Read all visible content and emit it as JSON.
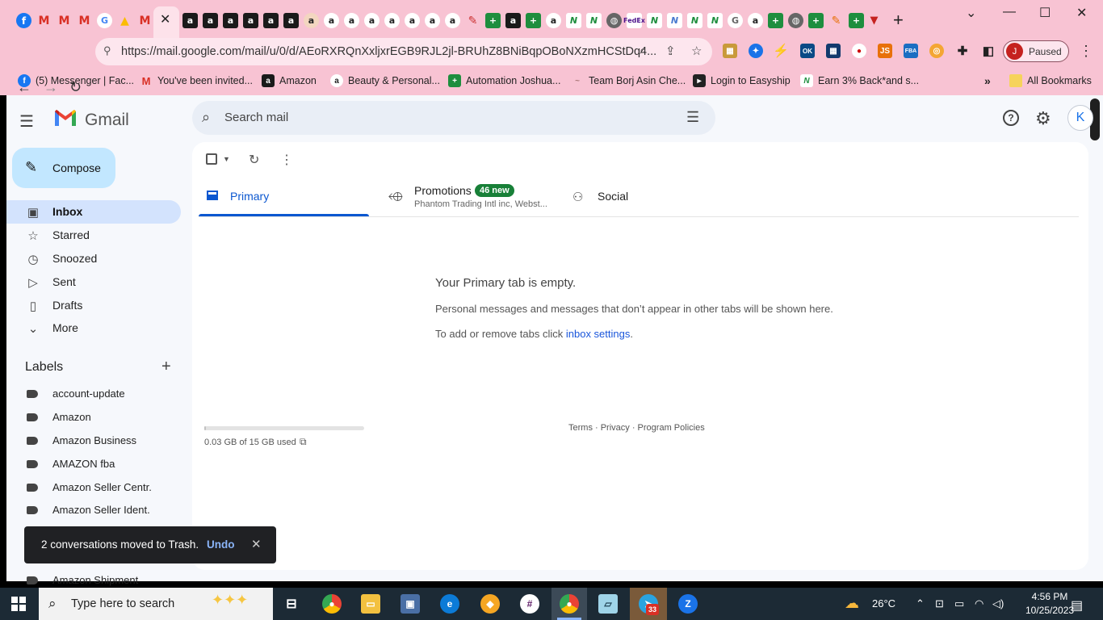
{
  "browser": {
    "window_controls": {
      "minimize": "—",
      "maximize": "☐",
      "close": "✕",
      "list": "⌄"
    },
    "tab_favicons": [
      {
        "kind": "facebook-icon",
        "glyph": "f"
      },
      {
        "kind": "gmail-icon",
        "glyph": "M"
      },
      {
        "kind": "gmail-icon",
        "glyph": "M"
      },
      {
        "kind": "gmail-icon",
        "glyph": "M"
      },
      {
        "kind": "google-icon",
        "glyph": "G"
      },
      {
        "kind": "drive-icon",
        "glyph": "▲"
      },
      {
        "kind": "gmail-icon",
        "glyph": "M"
      }
    ],
    "active_tab_close": "✕",
    "amazon_tab_glyph": "a",
    "new_tab": "+",
    "url": "https://mail.google.com/mail/u/0/#inbox",
    "url_display": "https://mail.google.com/mail/u/0/d/AEoRXRQnXxljxrEGB9RJL2jl-BRUhZ8BNiBqpOBoNXzmHCStDq4...",
    "profile": {
      "initial": "J",
      "status": "Paused"
    },
    "bookmarks": [
      {
        "label": "(5) Messenger | Fac...",
        "icon": "f",
        "color": "#1877f2"
      },
      {
        "label": "You've been invited...",
        "icon": "M",
        "color": "#d93025"
      },
      {
        "label": "Amazon",
        "icon": "a",
        "color": "#1a1a1a"
      },
      {
        "label": "Beauty & Personal...",
        "icon": "a",
        "color": "#1a1a1a"
      },
      {
        "label": "Automation Joshua...",
        "icon": "+",
        "color": "#1e8e3e"
      },
      {
        "label": "Team Borj Asin Che...",
        "icon": "~",
        "color": "#a77"
      },
      {
        "label": "Login to Easyship",
        "icon": "▸",
        "color": "#222"
      },
      {
        "label": "Earn 3% Back*and s...",
        "icon": "N",
        "color": "#1e8e3e"
      }
    ],
    "bookmarks_more": "»",
    "all_bookmarks": "All Bookmarks"
  },
  "gmail": {
    "brand": "Gmail",
    "search_placeholder": "Search mail",
    "account_initial": "K",
    "compose_label": "Compose",
    "nav": [
      {
        "label": "Inbox",
        "icon": "▣",
        "active": true
      },
      {
        "label": "Starred",
        "icon": "☆",
        "active": false
      },
      {
        "label": "Snoozed",
        "icon": "◷",
        "active": false
      },
      {
        "label": "Sent",
        "icon": "▷",
        "active": false
      },
      {
        "label": "Drafts",
        "icon": "▯",
        "active": false
      },
      {
        "label": "More",
        "icon": "⌄",
        "active": false
      }
    ],
    "labels_title": "Labels",
    "labels": [
      "account-update",
      "Amazon",
      "Amazon Business",
      "AMAZON fba",
      "Amazon Seller Centr.",
      "Amazon Seller Ident."
    ],
    "clipped_label": "Amazon Shipment",
    "tabs": {
      "primary": "Primary",
      "promotions": "Promotions",
      "promotions_badge": "46 new",
      "promotions_snippet": "Phantom Trading Intl inc, Webst...",
      "social": "Social"
    },
    "empty": {
      "title": "Your Primary tab is empty.",
      "text": "Personal messages and messages that don’t appear in other tabs will be shown here.",
      "settings_prefix": "To add or remove tabs click ",
      "settings_link": "inbox settings",
      "settings_suffix": "."
    },
    "storage": {
      "text": "0.03 GB of 15 GB used",
      "fraction": 0.002
    },
    "footer": "Terms · Privacy · Program Policies",
    "toast": {
      "message": "2 conversations moved to Trash.",
      "action": "Undo",
      "close": "✕"
    }
  },
  "taskbar": {
    "search_placeholder": "Type here to search",
    "weather": "26°C",
    "time": "4:56 PM",
    "date": "10/25/2023",
    "badge": "33"
  },
  "colors": {
    "accent": "#0b57d0",
    "active_nav": "#d3e3fd",
    "compose": "#c2e7ff",
    "chrome_frame": "#f8c3d3"
  }
}
